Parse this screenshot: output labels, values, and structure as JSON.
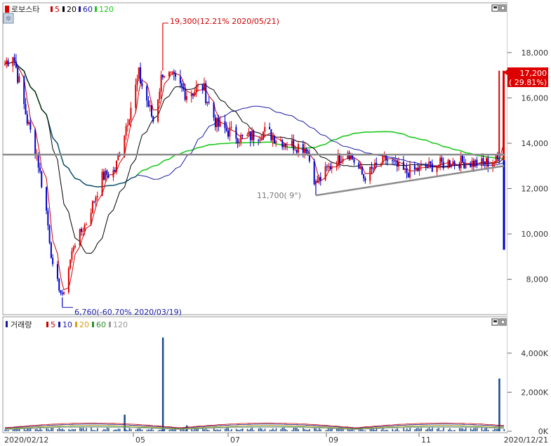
{
  "price_panel": {
    "title": "로보스타",
    "legend": [
      {
        "label": "5",
        "color": "#cc0000"
      },
      {
        "label": "20",
        "color": "#000000"
      },
      {
        "label": "60",
        "color": "#1a1aa8"
      },
      {
        "label": "120",
        "color": "#1ec81e"
      }
    ],
    "y_ticks": [
      "18,000",
      "16,000",
      "14,000",
      "12,000",
      "10,000",
      "8,000"
    ],
    "current_price": "17,200",
    "current_change": "( 29.81%)",
    "annotations": {
      "high": "19,300(12.21% 2020/05/21)",
      "low": "6,760(-60.70% 2020/03/19)",
      "mid": "11,700(   9°)"
    }
  },
  "volume_panel": {
    "title": "거래량",
    "legend": [
      {
        "label": "5",
        "color": "#cc0000"
      },
      {
        "label": "10",
        "color": "#1a1aa8"
      },
      {
        "label": "20",
        "color": "#d4a017"
      },
      {
        "label": "60",
        "color": "#2f8f2f"
      },
      {
        "label": "120",
        "color": "#999999"
      }
    ],
    "y_ticks": [
      "4,000K",
      "2,000K",
      "0K"
    ]
  },
  "x_ticks": [
    "2020/02/12",
    "05",
    "07",
    "09",
    "11",
    "2020/12/21"
  ],
  "colors": {
    "up": "#dd0000",
    "down": "#0000cc",
    "ma5": "#cc0000",
    "ma20": "#000000",
    "ma60": "#1a1aa8",
    "ma120": "#1ec81e",
    "trendline": "#8c8c8c"
  },
  "chart_data": {
    "type": "candlestick",
    "x_range": [
      "2020/02/12",
      "2020/12/21"
    ],
    "y_range": [
      6500,
      19700
    ],
    "horizontal_line": 13500,
    "trendline": [
      {
        "date": "2020/08/25",
        "value": 11700
      },
      {
        "date": "2020/12/21",
        "value": 13000
      }
    ],
    "ohlc_keypoints": [
      {
        "date": "2020/02/12",
        "close": 17500
      },
      {
        "date": "2020/02/17",
        "close": 18000
      },
      {
        "date": "2020/02/26",
        "close": 15000
      },
      {
        "date": "2020/03/03",
        "close": 13500
      },
      {
        "date": "2020/03/09",
        "close": 11000
      },
      {
        "date": "2020/03/13",
        "close": 8500
      },
      {
        "date": "2020/03/19",
        "low": 6760,
        "close": 7200
      },
      {
        "date": "2020/03/26",
        "close": 9500
      },
      {
        "date": "2020/04/03",
        "close": 10500
      },
      {
        "date": "2020/04/13",
        "close": 12500
      },
      {
        "date": "2020/04/21",
        "close": 12800
      },
      {
        "date": "2020/04/28",
        "close": 14800
      },
      {
        "date": "2020/05/06",
        "close": 17000
      },
      {
        "date": "2020/05/15",
        "close": 15000
      },
      {
        "date": "2020/05/21",
        "high": 19300,
        "close": 17200
      },
      {
        "date": "2020/06/05",
        "close": 16200
      },
      {
        "date": "2020/06/15",
        "close": 16500
      },
      {
        "date": "2020/06/24",
        "close": 14800
      },
      {
        "date": "2020/07/10",
        "close": 14200
      },
      {
        "date": "2020/07/24",
        "close": 14500
      },
      {
        "date": "2020/08/07",
        "close": 14000
      },
      {
        "date": "2020/08/19",
        "close": 13800
      },
      {
        "date": "2020/08/25",
        "low": 11700,
        "close": 12200
      },
      {
        "date": "2020/09/03",
        "close": 13000
      },
      {
        "date": "2020/09/14",
        "close": 13700
      },
      {
        "date": "2020/09/24",
        "close": 12500
      },
      {
        "date": "2020/10/08",
        "close": 13300
      },
      {
        "date": "2020/10/20",
        "close": 12700
      },
      {
        "date": "2020/11/06",
        "close": 13000
      },
      {
        "date": "2020/11/20",
        "close": 13200
      },
      {
        "date": "2020/12/07",
        "close": 13100
      },
      {
        "date": "2020/12/17",
        "close": 13250
      },
      {
        "date": "2020/12/18",
        "high": 17200,
        "close": 13500
      },
      {
        "date": "2020/12/21",
        "open": 13250,
        "high": 17200,
        "low": 9300,
        "close": 17200
      }
    ],
    "volume": [
      {
        "date": "2020/04/27",
        "value": 850000
      },
      {
        "date": "2020/05/21",
        "value": 4800000
      },
      {
        "date": "2020/06/05",
        "value": 300000
      },
      {
        "date": "2020/12/18",
        "value": 2700000
      }
    ],
    "volume_range": [
      0,
      5000000
    ]
  }
}
